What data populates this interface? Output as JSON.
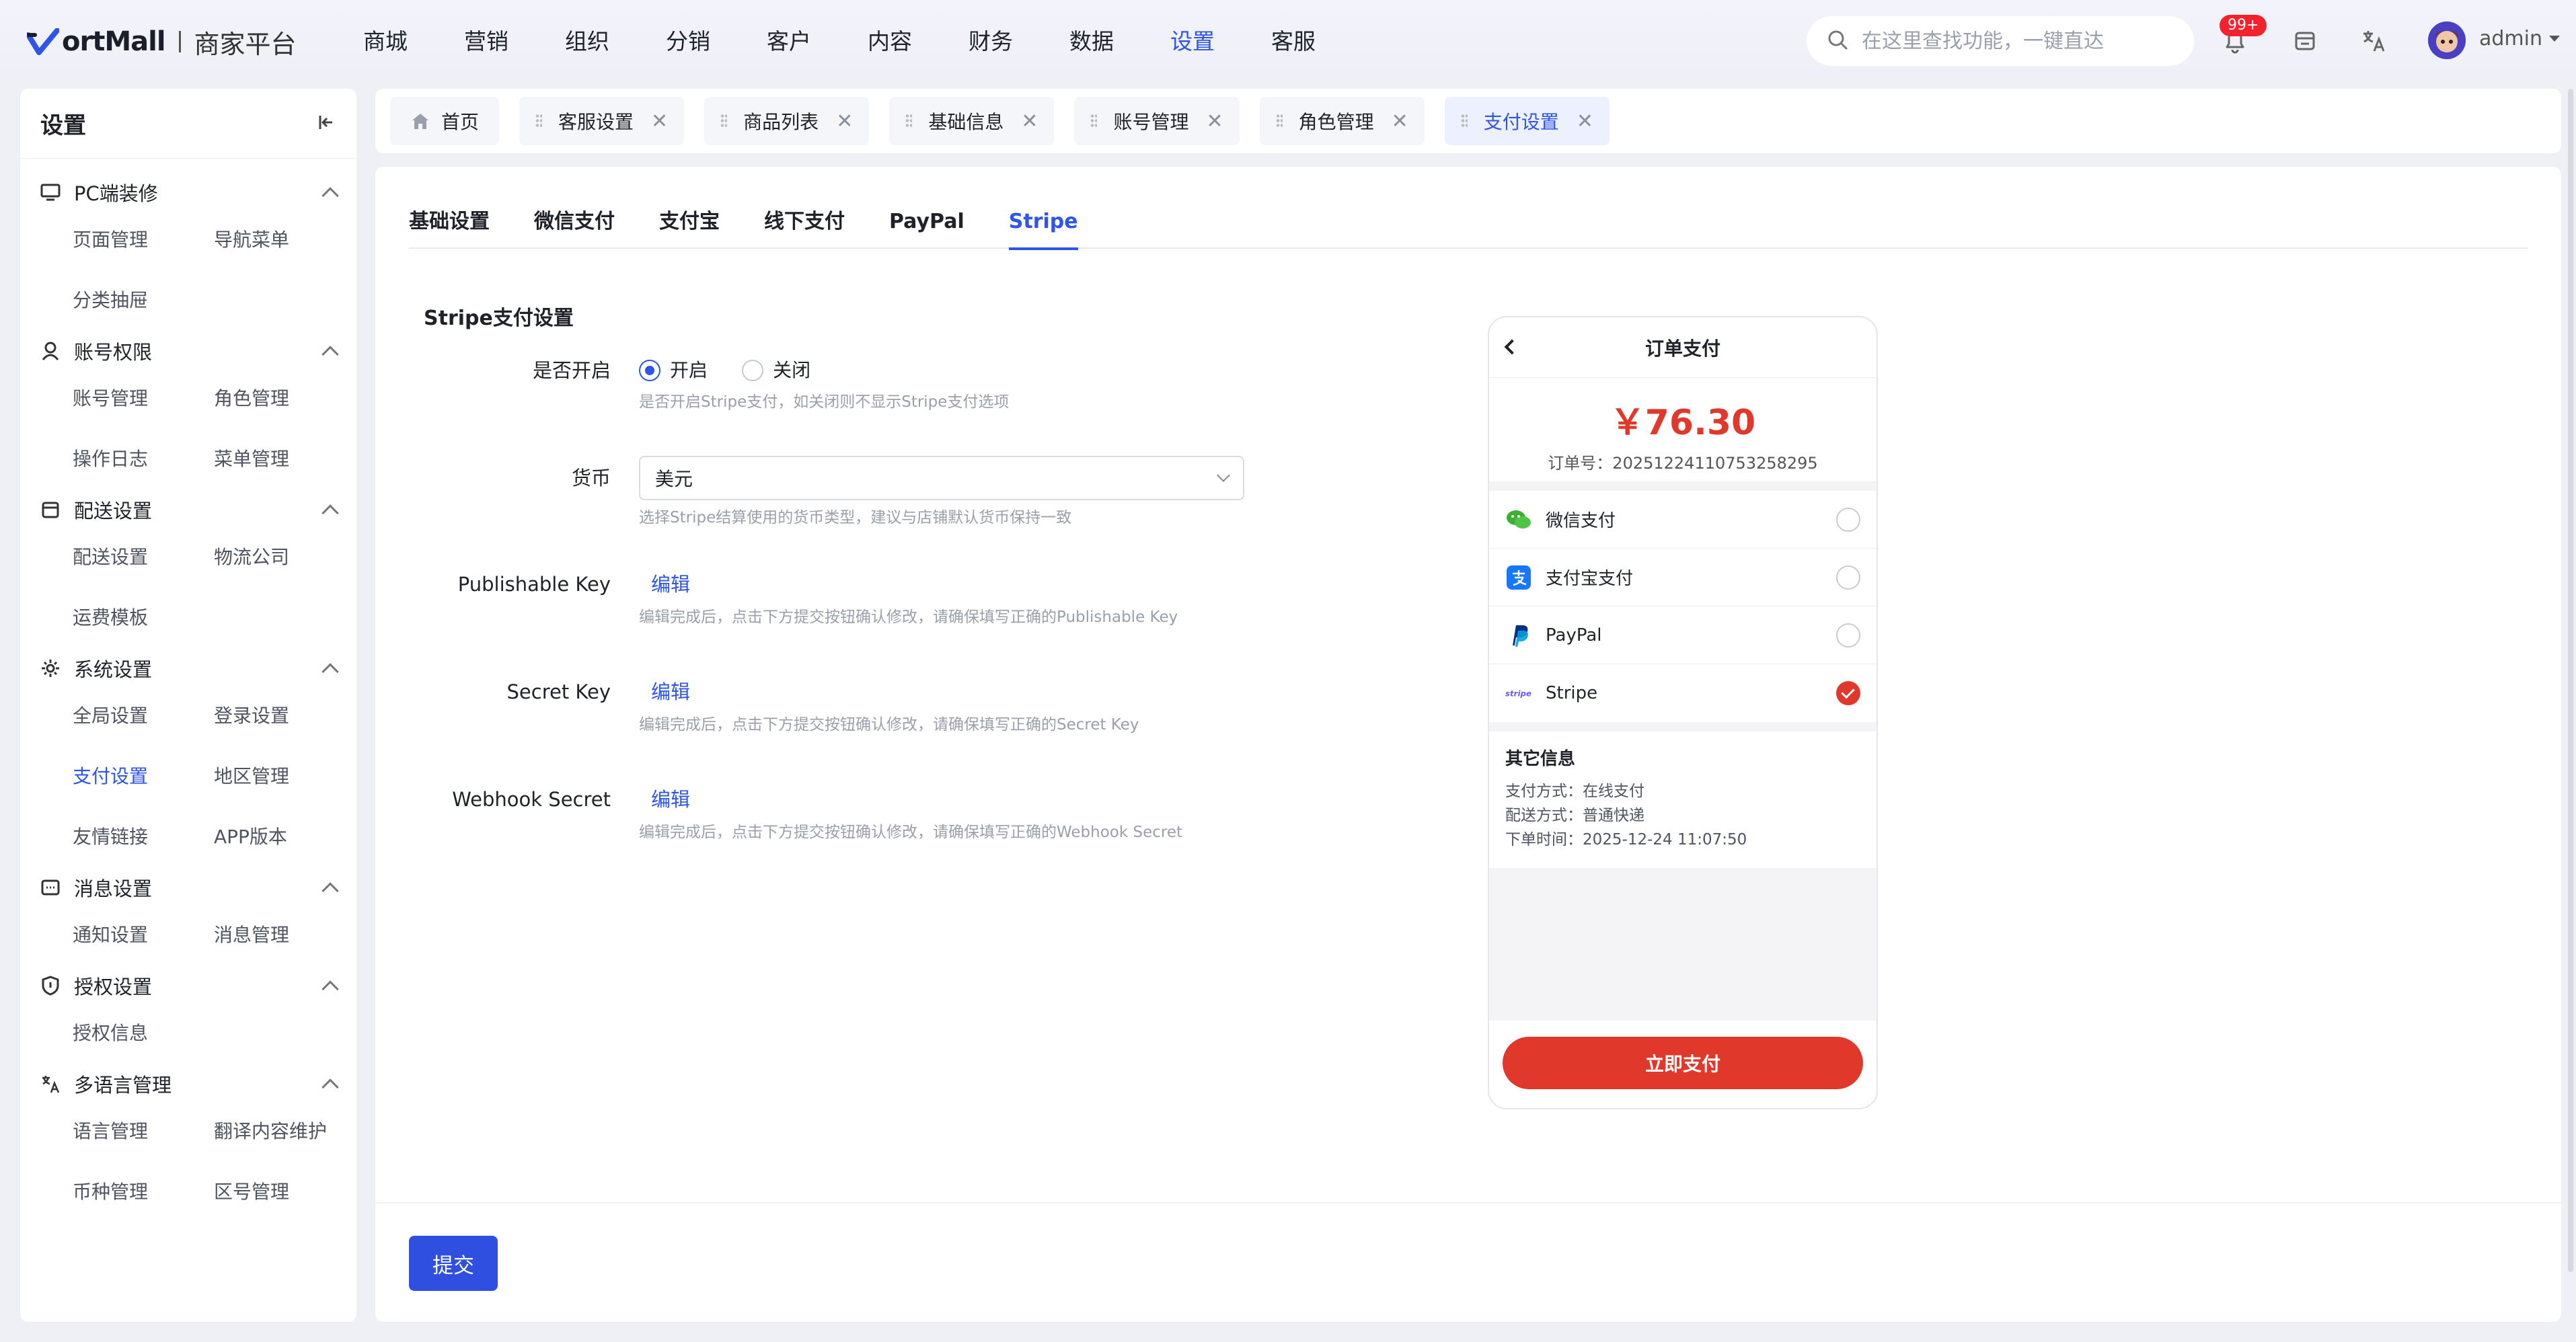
{
  "app": {
    "brand": "ortMall",
    "subtitle": "商家平台",
    "nav": [
      "商城",
      "营销",
      "组织",
      "分销",
      "客户",
      "内容",
      "财务",
      "数据",
      "设置",
      "客服"
    ],
    "nav_active": "设置",
    "search_placeholder": "在这里查找功能，一键直达",
    "notification_badge": "99+",
    "user": "admin"
  },
  "sidebar": {
    "title": "设置",
    "groups": [
      {
        "label": "PC端装修",
        "icon": "monitor-icon",
        "items": [
          "页面管理",
          "导航菜单",
          "分类抽屉"
        ]
      },
      {
        "label": "账号权限",
        "icon": "user-icon",
        "items": [
          "账号管理",
          "角色管理",
          "操作日志",
          "菜单管理"
        ]
      },
      {
        "label": "配送设置",
        "icon": "delivery-icon",
        "items": [
          "配送设置",
          "物流公司",
          "运费模板"
        ]
      },
      {
        "label": "系统设置",
        "icon": "settings-icon",
        "items": [
          "全局设置",
          "登录设置",
          "支付设置",
          "地区管理",
          "友情链接",
          "APP版本"
        ]
      },
      {
        "label": "消息设置",
        "icon": "message-icon",
        "items": [
          "通知设置",
          "消息管理"
        ]
      },
      {
        "label": "授权设置",
        "icon": "shield-icon",
        "items": [
          "授权信息"
        ]
      },
      {
        "label": "多语言管理",
        "icon": "translate-icon",
        "items": [
          "语言管理",
          "翻译内容维护",
          "币种管理",
          "区号管理"
        ]
      }
    ],
    "active_item": "支付设置"
  },
  "tabs": [
    {
      "label": "首页",
      "closable": false,
      "active": false
    },
    {
      "label": "客服设置",
      "closable": true,
      "active": false
    },
    {
      "label": "商品列表",
      "closable": true,
      "active": false
    },
    {
      "label": "基础信息",
      "closable": true,
      "active": false
    },
    {
      "label": "账号管理",
      "closable": true,
      "active": false
    },
    {
      "label": "角色管理",
      "closable": true,
      "active": false
    },
    {
      "label": "支付设置",
      "closable": true,
      "active": true
    }
  ],
  "subtabs": [
    "基础设置",
    "微信支付",
    "支付宝",
    "线下支付",
    "PayPal",
    "Stripe"
  ],
  "subtab_active": "Stripe",
  "form": {
    "title": "Stripe支付设置",
    "enable": {
      "label": "是否开启",
      "options": [
        "开启",
        "关闭"
      ],
      "selected": "开启",
      "help": "是否开启Stripe支付，如关闭则不显示Stripe支付选项"
    },
    "currency": {
      "label": "货币",
      "value": "美元",
      "help": "选择Stripe结算使用的货币类型，建议与店铺默认货币保持一致"
    },
    "publishable_key": {
      "label": "Publishable Key",
      "action": "编辑",
      "help": "编辑完成后，点击下方提交按钮确认修改，请确保填写正确的Publishable Key"
    },
    "secret_key": {
      "label": "Secret Key",
      "action": "编辑",
      "help": "编辑完成后，点击下方提交按钮确认修改，请确保填写正确的Secret Key"
    },
    "webhook_secret": {
      "label": "Webhook Secret",
      "action": "编辑",
      "help": "编辑完成后，点击下方提交按钮确认修改，请确保填写正确的Webhook Secret"
    },
    "submit": "提交"
  },
  "preview": {
    "title": "订单支付",
    "amount": "￥76.30",
    "order_no": "订单号：20251224110753258295",
    "methods": [
      {
        "label": "微信支付",
        "icon": "wechat-pay-icon",
        "selected": false
      },
      {
        "label": "支付宝支付",
        "icon": "alipay-icon",
        "selected": false
      },
      {
        "label": "PayPal",
        "icon": "paypal-icon",
        "selected": false
      },
      {
        "label": "Stripe",
        "icon": "stripe-icon",
        "selected": true
      }
    ],
    "other_title": "其它信息",
    "other_lines": [
      "支付方式：在线支付",
      "配送方式：普通快递",
      "下单时间：2025-12-24 11:07:50"
    ],
    "pay_button": "立即支付"
  },
  "colors": {
    "primary": "#2f54eb",
    "accent_red": "#e0392b",
    "badge_red": "#f5222d"
  }
}
